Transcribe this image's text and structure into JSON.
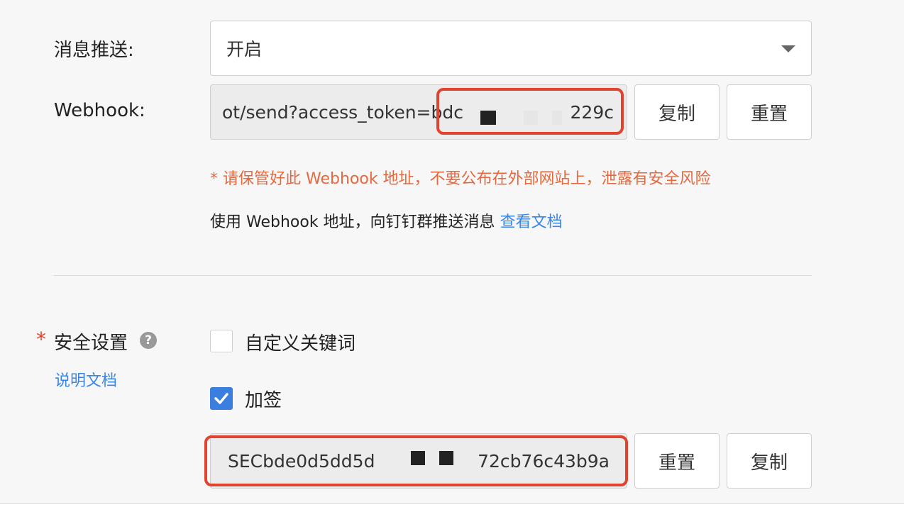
{
  "push": {
    "label": "消息推送:",
    "value": "开启"
  },
  "webhook": {
    "label": "Webhook:",
    "value": "ot/send?access_token=bdc",
    "tail": "229c",
    "copy_label": "复制",
    "reset_label": "重置",
    "warning": "* 请保管好此 Webhook 地址，不要公布在外部网站上，泄露有安全风险",
    "hint": "使用 Webhook 地址，向钉钉群推送消息",
    "hint_link": "查看文档"
  },
  "security": {
    "required_mark": "*",
    "label": "安全设置",
    "help_icon": "?",
    "doc_link": "说明文档",
    "keyword_label": "自定义关键词",
    "keyword_checked": false,
    "sign_label": "加签",
    "sign_checked": true,
    "secret_prefix": "SECbde0d5dd5d",
    "secret_suffix": "72cb76c43b9a",
    "reset_label": "重置",
    "copy_label": "复制"
  },
  "colors": {
    "accent": "#3a7fe0",
    "warning": "#e5693f",
    "highlight_box": "#e0432e"
  }
}
